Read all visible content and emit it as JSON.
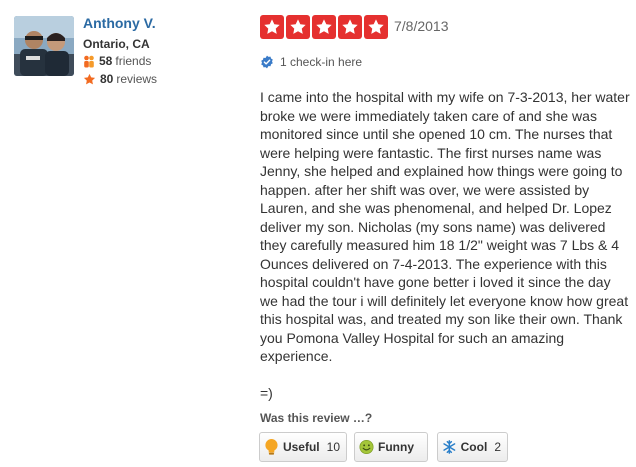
{
  "user": {
    "name": "Anthony V.",
    "location": "Ontario, CA",
    "friends_count": "58",
    "friends_label": "friends",
    "reviews_count": "80",
    "reviews_label": "reviews"
  },
  "review": {
    "rating": 5,
    "rating_max": 5,
    "date": "7/8/2013",
    "checkin_text": "1 check-in here",
    "body": "I came into the hospital with my wife on 7-3-2013, her water broke we were immediately taken care of and she was monitored since until she opened 10 cm. The nurses that were helping were fantastic. The first nurses name was Jenny, she helped and explained how things were going to happen. after her shift was over, we were assisted by Lauren, and she was phenomenal, and helped Dr. Lopez deliver my son. Nicholas (my sons name) was delivered they carefully measured him 18 1/2\" weight was 7 Lbs & 4 Ounces delivered on 7-4-2013. The experience with this hospital couldn't have gone better i loved it since the day we had the tour i will definitely let  everyone know how great this hospital was, and treated my son like their own. Thank you Pomona Valley Hospital for such an amazing experience.\n\n=)"
  },
  "votes": {
    "question": "Was this review …?",
    "useful": {
      "label": "Useful",
      "count": "10",
      "icon": "lightbulb-icon"
    },
    "funny": {
      "label": "Funny",
      "count": "",
      "icon": "smiley-icon"
    },
    "cool": {
      "label": "Cool",
      "count": "2",
      "icon": "snowflake-icon"
    }
  },
  "colors": {
    "star_red": "#e5302f",
    "username_blue": "#2b6aa3"
  }
}
